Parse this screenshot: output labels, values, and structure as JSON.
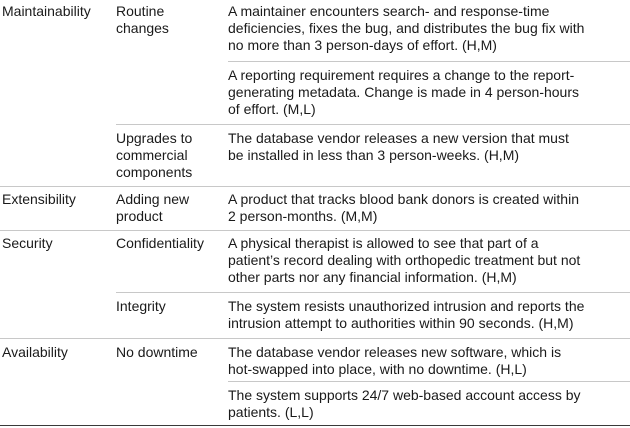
{
  "table": {
    "rows": [
      {
        "attribute": "Maintainability",
        "refinement": [
          "Routine",
          "changes"
        ],
        "scenario": [
          "A maintainer encounters search- and response-time",
          "deficiencies, fixes the bug, and distributes the bug fix with",
          "no more than 3 person-days of effort. (H,M)"
        ]
      },
      {
        "attribute": "",
        "refinement": [],
        "scenario": [
          "A reporting requirement requires a change to the report-",
          "generating metadata. Change is made in 4 person-hours",
          "of effort. (M,L)"
        ]
      },
      {
        "attribute": "",
        "refinement": [
          "Upgrades to",
          "commercial",
          "components"
        ],
        "scenario": [
          "The database vendor releases a new version that must",
          "be installed in less than 3 person-weeks. (H,M)"
        ]
      },
      {
        "attribute": "Extensibility",
        "refinement": [
          "Adding new",
          "product"
        ],
        "scenario": [
          "A product that tracks blood bank donors is created within",
          "2 person-months. (M,M)"
        ]
      },
      {
        "attribute": "Security",
        "refinement": [
          "Confidentiality"
        ],
        "scenario": [
          "A physical therapist is allowed to see that part of a",
          "patient’s record dealing with orthopedic treatment but not",
          "other parts nor any financial information. (H,M)"
        ]
      },
      {
        "attribute": "",
        "refinement": [
          "Integrity"
        ],
        "scenario": [
          "The system resists unauthorized intrusion and reports the",
          "intrusion attempt to authorities within 90 seconds. (H,M)"
        ]
      },
      {
        "attribute": "Availability",
        "refinement": [
          "No downtime"
        ],
        "scenario": [
          "The database vendor releases new software, which is",
          "hot-swapped into place, with no downtime. (H,L)"
        ]
      },
      {
        "attribute": "",
        "refinement": [],
        "scenario": [
          "The system supports 24/7 web-based account access by",
          "patients. (L,L)"
        ]
      }
    ]
  }
}
